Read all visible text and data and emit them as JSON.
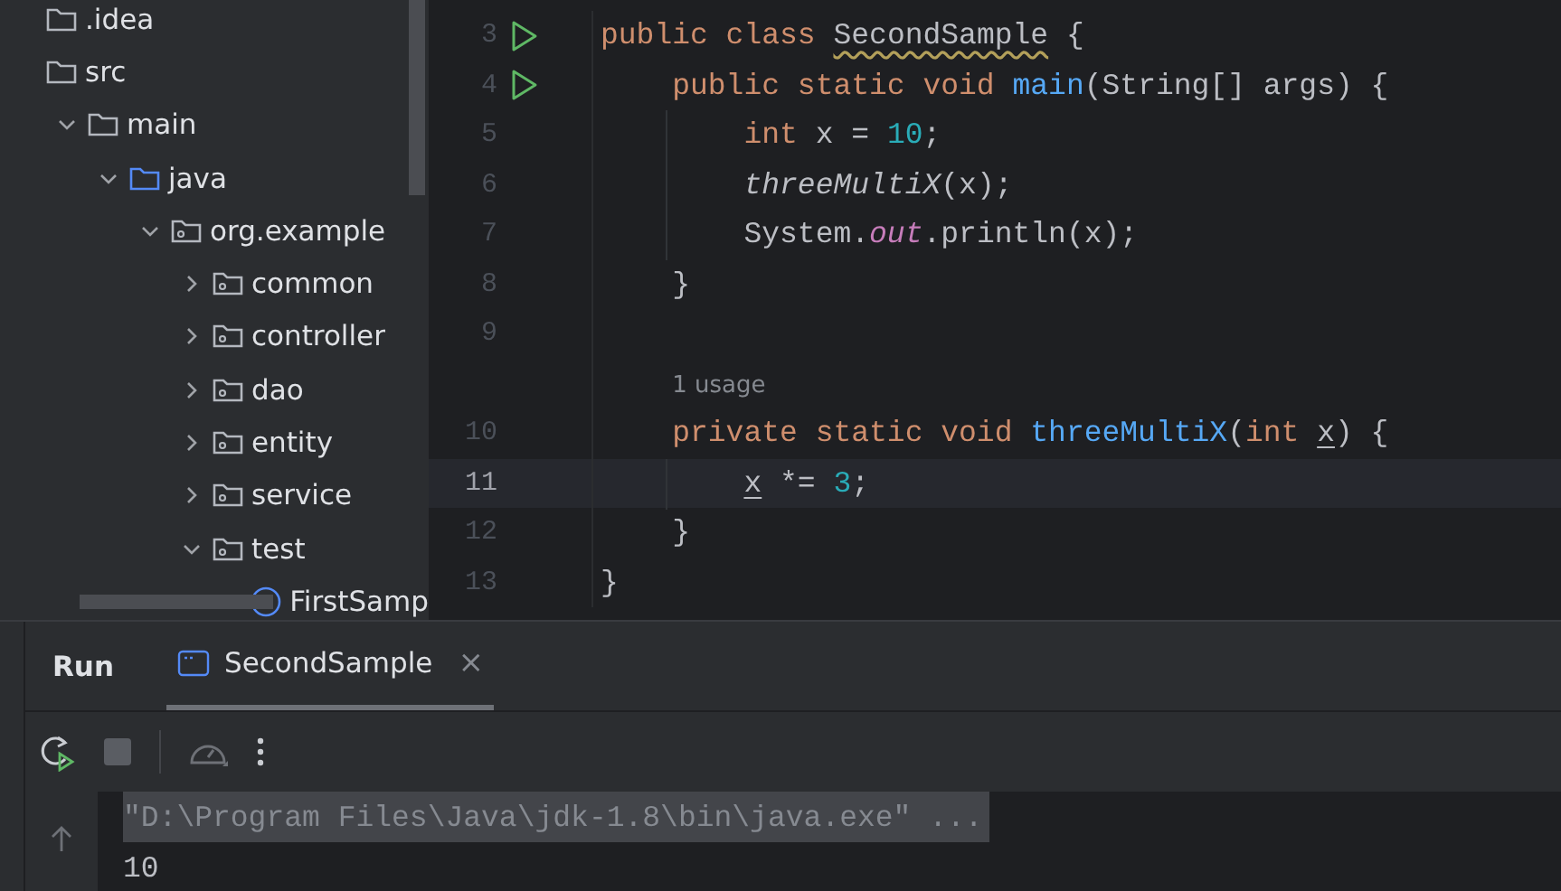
{
  "project_tree": [
    {
      "label": ".idea",
      "kind": "folder"
    },
    {
      "label": "src",
      "kind": "folder",
      "children": [
        {
          "label": "main",
          "kind": "folder",
          "expanded": true,
          "children": [
            {
              "label": "java",
              "kind": "source-folder",
              "expanded": true,
              "children": [
                {
                  "label": "org.example",
                  "kind": "package",
                  "expanded": true,
                  "children": [
                    {
                      "label": "common",
                      "kind": "package",
                      "expanded": false
                    },
                    {
                      "label": "controller",
                      "kind": "package",
                      "expanded": false
                    },
                    {
                      "label": "dao",
                      "kind": "package",
                      "expanded": false
                    },
                    {
                      "label": "entity",
                      "kind": "package",
                      "expanded": false
                    },
                    {
                      "label": "service",
                      "kind": "package",
                      "expanded": false
                    },
                    {
                      "label": "test",
                      "kind": "package",
                      "expanded": true,
                      "children": [
                        {
                          "label": "FirstSamp",
                          "kind": "class"
                        }
                      ]
                    }
                  ]
                }
              ]
            }
          ]
        }
      ]
    }
  ],
  "editor": {
    "lines": [
      {
        "number": "3",
        "run_button": true,
        "current": false,
        "tokens": [
          {
            "text": "public class ",
            "kind": "keyword"
          },
          {
            "text": "SecondSample",
            "kind": "warning"
          },
          {
            "text": " {",
            "kind": "plain"
          }
        ]
      },
      {
        "number": "4",
        "run_button": true,
        "current": false,
        "tokens": [
          {
            "text": "    public static void ",
            "kind": "keyword"
          },
          {
            "text": "main",
            "kind": "declaration"
          },
          {
            "text": "(String[] args) {",
            "kind": "plain"
          }
        ]
      },
      {
        "number": "5",
        "current": false,
        "tokens": [
          {
            "text": "        int ",
            "kind": "keyword"
          },
          {
            "text": "x = ",
            "kind": "plain"
          },
          {
            "text": "10",
            "kind": "number"
          },
          {
            "text": ";",
            "kind": "plain"
          }
        ]
      },
      {
        "number": "6",
        "current": false,
        "tokens": [
          {
            "text": "        threeMultiX",
            "kind": "static-call"
          },
          {
            "text": "(x);",
            "kind": "plain"
          }
        ]
      },
      {
        "number": "7",
        "current": false,
        "tokens": [
          {
            "text": "        System.",
            "kind": "plain"
          },
          {
            "text": "out",
            "kind": "static-field"
          },
          {
            "text": ".println(x);",
            "kind": "plain"
          }
        ]
      },
      {
        "number": "8",
        "current": false,
        "tokens": [
          {
            "text": "    }",
            "kind": "plain"
          }
        ]
      },
      {
        "number": "9",
        "current": false
      },
      {
        "number": "10",
        "current": false,
        "hint": "1 usage",
        "tokens": [
          {
            "text": "    private static void ",
            "kind": "keyword"
          },
          {
            "text": "threeMultiX",
            "kind": "declaration"
          },
          {
            "text": "(",
            "kind": "plain"
          },
          {
            "text": "int ",
            "kind": "keyword"
          },
          {
            "text": "x",
            "kind": "reassigned"
          },
          {
            "text": ") {",
            "kind": "plain"
          }
        ]
      },
      {
        "number": "11",
        "current": true,
        "tokens": [
          {
            "text": "        x",
            "kind": "reassigned"
          },
          {
            "text": " *= ",
            "kind": "plain"
          },
          {
            "text": "3",
            "kind": "number"
          },
          {
            "text": ";",
            "kind": "plain"
          }
        ]
      },
      {
        "number": "12",
        "current": false,
        "tokens": [
          {
            "text": "    }",
            "kind": "plain"
          }
        ]
      },
      {
        "number": "13",
        "current": false,
        "tokens": [
          {
            "text": "}",
            "kind": "plain"
          }
        ]
      }
    ]
  },
  "run_panel": {
    "title": "Run",
    "tabs": [
      {
        "label": "SecondSample",
        "selected": true,
        "close": "×"
      }
    ],
    "toolbar": [
      {
        "kind": "rerun"
      },
      {
        "kind": "stop",
        "disabled": true
      },
      {
        "kind": "separator"
      },
      {
        "kind": "profiler"
      },
      {
        "kind": "more"
      }
    ],
    "console": [
      {
        "text": "\"D:\\Program Files\\Java\\jdk-1.8\\bin\\java.exe\" ...",
        "kind": "command"
      },
      {
        "text": "10",
        "kind": "output"
      }
    ]
  }
}
